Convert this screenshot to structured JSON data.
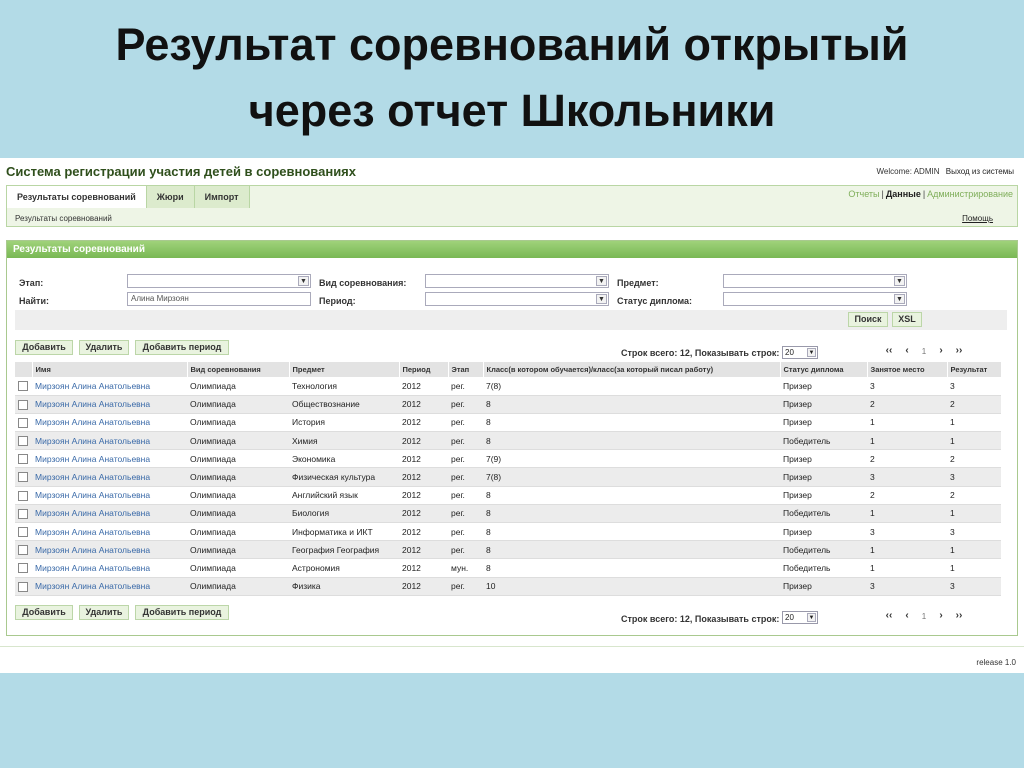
{
  "slide": {
    "title_line1": "Результат соревнований открытый",
    "title_line2": "через отчет Школьники"
  },
  "header": {
    "app_title": "Система регистрации участия детей в соревнованиях",
    "welcome": "Welcome: ADMIN",
    "logout": "Выход из системы"
  },
  "tabs": [
    {
      "label": "Результаты соревнований"
    },
    {
      "label": "Жюри"
    },
    {
      "label": "Импорт"
    }
  ],
  "topmenu": {
    "reports": "Отчеты",
    "data": "Данные",
    "admin": "Администрирование",
    "sep": "|"
  },
  "breadcrumb": "Результаты соревнований",
  "help": "Помощь",
  "panel": {
    "title": "Результаты соревнований"
  },
  "filters": {
    "stage_label": "Этап:",
    "competition_type_label": "Вид соревнования:",
    "subject_label": "Предмет:",
    "find_label": "Найти:",
    "find_value": "Алина Мирзоян",
    "period_label": "Период:",
    "diploma_status_label": "Статус диплома:",
    "search_button": "Поиск",
    "xsl_button": "XSL"
  },
  "toolbar": {
    "add": "Добавить",
    "delete": "Удалить",
    "add_period": "Добавить период"
  },
  "pager": {
    "info": "Строк всего: 12, Показывать строк:",
    "page_size": "20",
    "first": "‹‹",
    "prev": "‹",
    "page": "1",
    "next": "›",
    "last": "››"
  },
  "table": {
    "columns": [
      "Имя",
      "Вид соревнования",
      "Предмет",
      "Период",
      "Этап",
      "Класс(в котором обучается)/класс(за который писал работу)",
      "Статус диплома",
      "Занятое место",
      "Результат"
    ],
    "rows": [
      [
        "Мирзоян Алина Анатольевна",
        "Олимпиада",
        "Технология",
        "2012",
        "рег.",
        "7(8)",
        "Призер",
        "3",
        "3"
      ],
      [
        "Мирзоян Алина Анатольевна",
        "Олимпиада",
        "Обществознание",
        "2012",
        "рег.",
        "8",
        "Призер",
        "2",
        "2"
      ],
      [
        "Мирзоян Алина Анатольевна",
        "Олимпиада",
        "История",
        "2012",
        "рег.",
        "8",
        "Призер",
        "1",
        "1"
      ],
      [
        "Мирзоян Алина Анатольевна",
        "Олимпиада",
        "Химия",
        "2012",
        "рег.",
        "8",
        "Победитель",
        "1",
        "1"
      ],
      [
        "Мирзоян Алина Анатольевна",
        "Олимпиада",
        "Экономика",
        "2012",
        "рег.",
        "7(9)",
        "Призер",
        "2",
        "2"
      ],
      [
        "Мирзоян Алина Анатольевна",
        "Олимпиада",
        "Физическая культура",
        "2012",
        "рег.",
        "7(8)",
        "Призер",
        "3",
        "3"
      ],
      [
        "Мирзоян Алина Анатольевна",
        "Олимпиада",
        "Английский язык",
        "2012",
        "рег.",
        "8",
        "Призер",
        "2",
        "2"
      ],
      [
        "Мирзоян Алина Анатольевна",
        "Олимпиада",
        "Биология",
        "2012",
        "рег.",
        "8",
        "Победитель",
        "1",
        "1"
      ],
      [
        "Мирзоян Алина Анатольевна",
        "Олимпиада",
        "Информатика и ИКТ",
        "2012",
        "рег.",
        "8",
        "Призер",
        "3",
        "3"
      ],
      [
        "Мирзоян Алина Анатольевна",
        "Олимпиада",
        "География География",
        "2012",
        "рег.",
        "8",
        "Победитель",
        "1",
        "1"
      ],
      [
        "Мирзоян Алина Анатольевна",
        "Олимпиада",
        "Астрономия",
        "2012",
        "мун.",
        "8",
        "Победитель",
        "1",
        "1"
      ],
      [
        "Мирзоян Алина Анатольевна",
        "Олимпиада",
        "Физика",
        "2012",
        "рег.",
        "10",
        "Призер",
        "3",
        "3"
      ]
    ]
  },
  "footer": {
    "release": "release 1.0"
  },
  "icons": {
    "dropdown": "chevron-down-icon",
    "checkbox": "checkbox-icon"
  }
}
